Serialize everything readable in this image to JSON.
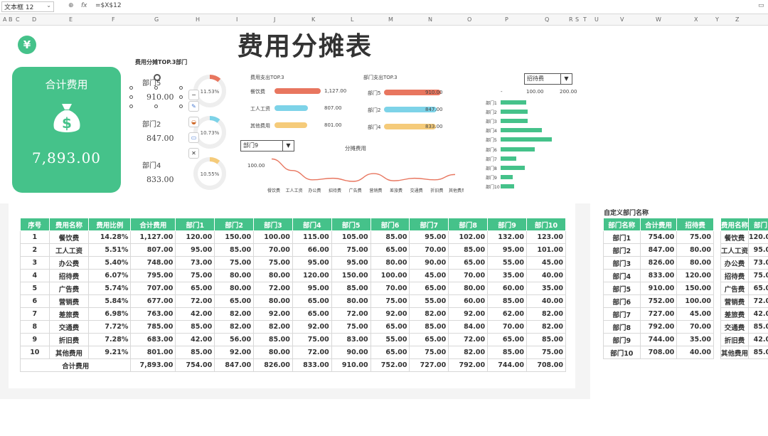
{
  "formula_bar": {
    "name_box": "文本框 12",
    "formula": "=$X$12"
  },
  "columns": [
    "A",
    "B",
    "C",
    "D",
    "E",
    "F",
    "G",
    "H",
    "I",
    "J",
    "K",
    "L",
    "M",
    "N",
    "O",
    "P",
    "Q",
    "R",
    "S",
    "T",
    "U",
    "V",
    "W",
    "X",
    "Y",
    "Z"
  ],
  "title": "费用分摊表",
  "logo": "¥",
  "total_card": {
    "label": "合计费用",
    "value": "7,893.00"
  },
  "top3_dept": {
    "title": "费用分摊TOP.3部门",
    "items": [
      {
        "name": "部门5",
        "value": "910.00",
        "pct": "11.53%",
        "frac": 0.1153,
        "color": "#e8765f"
      },
      {
        "name": "部门2",
        "value": "847.00",
        "pct": "10.73%",
        "frac": 0.1073,
        "color": "#7dd3e8"
      },
      {
        "name": "部门4",
        "value": "833.00",
        "pct": "10.55%",
        "frac": 0.1055,
        "color": "#f5cb7a"
      }
    ]
  },
  "expense_top3": {
    "title": "费用支出TOP.3",
    "items": [
      {
        "name": "餐饮费",
        "value": 1127,
        "label": "1,127.00",
        "color": "#e8765f"
      },
      {
        "name": "工人工资",
        "value": 807,
        "label": "807.00",
        "color": "#7dd3e8"
      },
      {
        "name": "其他费用",
        "value": 801,
        "label": "801.00",
        "color": "#f5cb7a"
      }
    ]
  },
  "dept_top3": {
    "title": "部门支出TOP.3",
    "items": [
      {
        "name": "部门5",
        "value": 910,
        "label": "910.00",
        "color": "#e8765f"
      },
      {
        "name": "部门2",
        "value": 847,
        "label": "847.00",
        "color": "#7dd3e8"
      },
      {
        "name": "部门4",
        "value": 833,
        "label": "833.00",
        "color": "#f5cb7a"
      }
    ]
  },
  "line_chart": {
    "dropdown": "部门9",
    "title": "分摊费用",
    "y_tick": "100.00",
    "categories": [
      "餐饮费",
      "工人工资",
      "办公费",
      "招待费",
      "广告费",
      "营销费",
      "差旅费",
      "交通费",
      "折旧费",
      "其他费用"
    ],
    "values": [
      132,
      95,
      65,
      70,
      60,
      85,
      62,
      70,
      65,
      82
    ],
    "color": "#e8765f"
  },
  "hbar_chart": {
    "dropdown": "招待费",
    "ticks": [
      "-",
      "100.00",
      "200.00"
    ],
    "max": 200,
    "categories": [
      "部门1",
      "部门2",
      "部门3",
      "部门4",
      "部门5",
      "部门6",
      "部门7",
      "部门8",
      "部门9",
      "部门10"
    ],
    "values": [
      75,
      80,
      80,
      120,
      150,
      100,
      45,
      70,
      35,
      40
    ],
    "color": "#45c28a"
  },
  "main_table": {
    "headers": [
      "序号",
      "费用名称",
      "费用比例",
      "合计费用",
      "部门1",
      "部门2",
      "部门3",
      "部门4",
      "部门5",
      "部门6",
      "部门7",
      "部门8",
      "部门9",
      "部门10"
    ],
    "rows": [
      [
        "1",
        "餐饮费",
        "14.28%",
        "1,127.00",
        "120.00",
        "150.00",
        "100.00",
        "115.00",
        "105.00",
        "85.00",
        "95.00",
        "102.00",
        "132.00",
        "123.00"
      ],
      [
        "2",
        "工人工资",
        "5.51%",
        "807.00",
        "95.00",
        "85.00",
        "70.00",
        "66.00",
        "75.00",
        "65.00",
        "70.00",
        "85.00",
        "95.00",
        "101.00"
      ],
      [
        "3",
        "办公费",
        "5.40%",
        "748.00",
        "73.00",
        "75.00",
        "75.00",
        "95.00",
        "95.00",
        "80.00",
        "90.00",
        "65.00",
        "55.00",
        "45.00"
      ],
      [
        "4",
        "招待费",
        "6.07%",
        "795.00",
        "75.00",
        "80.00",
        "80.00",
        "120.00",
        "150.00",
        "100.00",
        "45.00",
        "70.00",
        "35.00",
        "40.00"
      ],
      [
        "5",
        "广告费",
        "5.74%",
        "707.00",
        "65.00",
        "80.00",
        "72.00",
        "95.00",
        "85.00",
        "70.00",
        "65.00",
        "80.00",
        "60.00",
        "35.00"
      ],
      [
        "6",
        "营销费",
        "5.84%",
        "677.00",
        "72.00",
        "65.00",
        "80.00",
        "65.00",
        "80.00",
        "75.00",
        "55.00",
        "60.00",
        "85.00",
        "40.00"
      ],
      [
        "7",
        "差旅费",
        "6.98%",
        "763.00",
        "42.00",
        "82.00",
        "92.00",
        "65.00",
        "72.00",
        "92.00",
        "82.00",
        "92.00",
        "62.00",
        "82.00"
      ],
      [
        "8",
        "交通费",
        "7.72%",
        "785.00",
        "85.00",
        "82.00",
        "82.00",
        "92.00",
        "75.00",
        "65.00",
        "85.00",
        "84.00",
        "70.00",
        "82.00"
      ],
      [
        "9",
        "折旧费",
        "7.28%",
        "683.00",
        "42.00",
        "56.00",
        "85.00",
        "75.00",
        "83.00",
        "55.00",
        "65.00",
        "72.00",
        "65.00",
        "85.00"
      ],
      [
        "10",
        "其他费用",
        "9.21%",
        "801.00",
        "85.00",
        "92.00",
        "80.00",
        "72.00",
        "90.00",
        "65.00",
        "75.00",
        "82.00",
        "85.00",
        "75.00"
      ]
    ],
    "total_row": [
      "",
      "合计费用",
      "",
      "7,893.00",
      "754.00",
      "847.00",
      "826.00",
      "833.00",
      "910.00",
      "752.00",
      "727.00",
      "792.00",
      "744.00",
      "708.00"
    ]
  },
  "custom_dept": {
    "title": "自定义部门名称",
    "headers": [
      "部门名称",
      "合计费用",
      "招待费"
    ],
    "rows": [
      [
        "部门1",
        "754.00",
        "75.00"
      ],
      [
        "部门2",
        "847.00",
        "80.00"
      ],
      [
        "部门3",
        "826.00",
        "80.00"
      ],
      [
        "部门4",
        "833.00",
        "120.00"
      ],
      [
        "部门5",
        "910.00",
        "150.00"
      ],
      [
        "部门6",
        "752.00",
        "100.00"
      ],
      [
        "部门7",
        "727.00",
        "45.00"
      ],
      [
        "部门8",
        "792.00",
        "70.00"
      ],
      [
        "部门9",
        "744.00",
        "35.00"
      ],
      [
        "部门10",
        "708.00",
        "40.00"
      ]
    ]
  },
  "expense_side": {
    "headers": [
      "费用名称",
      "部门1"
    ],
    "rows": [
      [
        "餐饮费",
        "120.00"
      ],
      [
        "工人工资",
        "95.00"
      ],
      [
        "办公费",
        "73.00"
      ],
      [
        "招待费",
        "75.00"
      ],
      [
        "广告费",
        "65.00"
      ],
      [
        "营销费",
        "72.00"
      ],
      [
        "差旅费",
        "42.00"
      ],
      [
        "交通费",
        "85.00"
      ],
      [
        "折旧费",
        "42.00"
      ],
      [
        "其他费用",
        "85.00"
      ]
    ]
  }
}
